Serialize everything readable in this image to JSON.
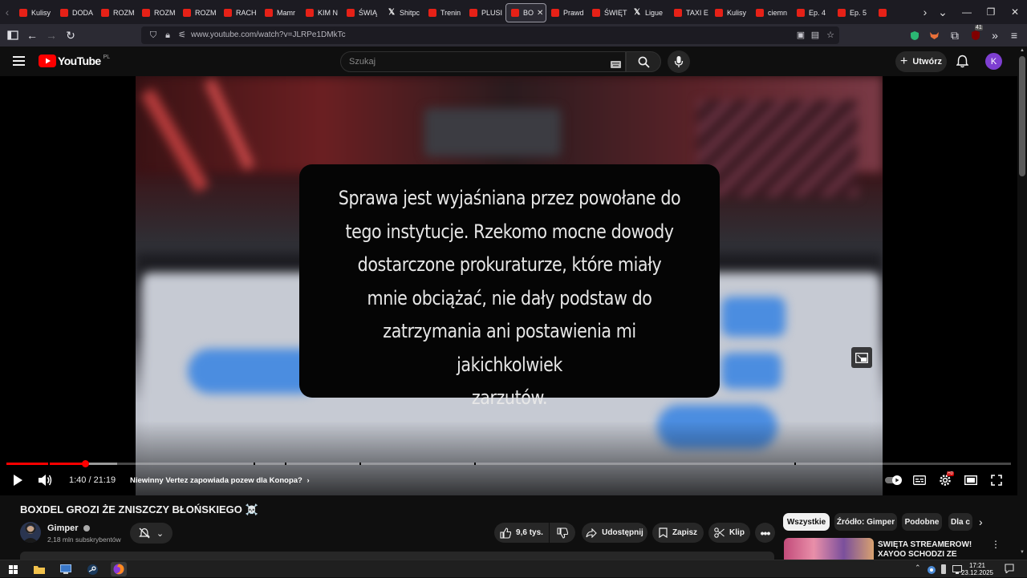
{
  "browser": {
    "tabs": [
      {
        "label": "Kulisy",
        "favicon": "youtube-icon"
      },
      {
        "label": "DODA",
        "favicon": "youtube-icon"
      },
      {
        "label": "ROZM",
        "favicon": "youtube-icon"
      },
      {
        "label": "ROZM",
        "favicon": "youtube-icon"
      },
      {
        "label": "ROZM",
        "favicon": "youtube-icon"
      },
      {
        "label": "RACH",
        "favicon": "youtube-icon"
      },
      {
        "label": "Mamr",
        "favicon": "youtube-icon"
      },
      {
        "label": "KIM N",
        "favicon": "youtube-icon"
      },
      {
        "label": "ŚWIĄ",
        "favicon": "youtube-icon"
      },
      {
        "label": "Shitpc",
        "favicon": "x-icon"
      },
      {
        "label": "Trenin",
        "favicon": "youtube-icon"
      },
      {
        "label": "PLUSI",
        "favicon": "youtube-icon"
      },
      {
        "label": "BO",
        "favicon": "youtube-icon",
        "active": true
      },
      {
        "label": "Prawd",
        "favicon": "youtube-icon"
      },
      {
        "label": "ŚWIĘT",
        "favicon": "youtube-icon"
      },
      {
        "label": "Ligue",
        "favicon": "x-icon"
      },
      {
        "label": "TAXI E",
        "favicon": "youtube-icon"
      },
      {
        "label": "Kulisy",
        "favicon": "youtube-icon"
      },
      {
        "label": "ciemn",
        "favicon": "youtube-icon"
      },
      {
        "label": "Ep. 4",
        "favicon": "youtube-icon"
      },
      {
        "label": "Ep. 5",
        "favicon": "youtube-icon"
      },
      {
        "label": "",
        "favicon": "youtube-icon"
      }
    ],
    "url": "www.youtube.com/watch?v=JLRPe1DMkTc",
    "extension_badge": "41"
  },
  "youtube": {
    "logo_text": "YouTube",
    "country_code": "PL",
    "search_placeholder": "Szukaj",
    "create_label": "Utwórz",
    "avatar_letter": "K",
    "accent_color": "#ff0000"
  },
  "player": {
    "subtitle_lines": [
      "Sprawa jest wyjaśniana przez powołane do",
      "tego instytucje. Rzekomo mocne dowody",
      "dostarczone prokuraturze, które miały",
      "mnie obciążać, nie dały podstaw do",
      "zatrzymania ani postawienia mi jakichkolwiek",
      "zarzutów."
    ],
    "current_time": "1:40",
    "duration": "21:19",
    "time_display": "1:40 / 21:19",
    "progress_fraction": 0.078,
    "buffer_fraction": 0.11,
    "chapter_title": "Niewinny Vertez zapowiada pozew dla Konopa?"
  },
  "video": {
    "title": "BOXDEL GROZI ŻE ZNISZCZY BŁOŃSKIEGO ☠️",
    "channel_name": "Gimper",
    "subscribers": "2,18 mln subskrybentów",
    "like_count": "9,6 tys.",
    "share_label": "Udostępnij",
    "save_label": "Zapisz",
    "clip_label": "Klip"
  },
  "recommendations": {
    "chips": [
      {
        "label": "Wszystkie",
        "active": true
      },
      {
        "label": "Źródło: Gimper"
      },
      {
        "label": "Podobne"
      },
      {
        "label": "Dla c"
      }
    ],
    "first_title": "ŚWIĘTA STREAMERÓW! XAYOO SCHODZI ZE SCENY?"
  },
  "taskbar": {
    "time": "17:21",
    "date": "23.12.2025"
  }
}
